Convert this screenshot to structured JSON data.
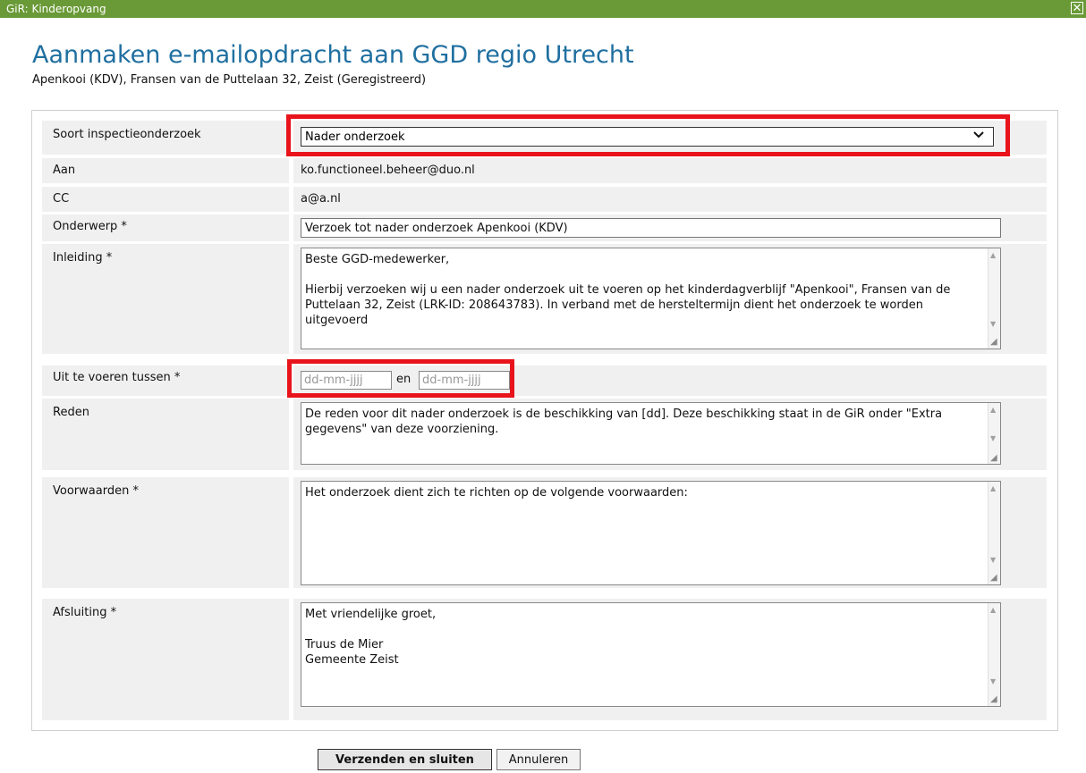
{
  "window": {
    "title": "GiR: Kinderopvang",
    "close_glyph": "✕"
  },
  "header": {
    "title": "Aanmaken e-mailopdracht aan GGD regio Utrecht",
    "subtitle": "Apenkooi (KDV), Fransen van de Puttelaan 32, Zeist (Geregistreerd)"
  },
  "form": {
    "soort": {
      "label": "Soort inspectieonderzoek",
      "value": "Nader onderzoek",
      "options": [
        "Nader onderzoek"
      ]
    },
    "aan": {
      "label": "Aan",
      "value": "ko.functioneel.beheer@duo.nl"
    },
    "cc": {
      "label": "CC",
      "value": "a@a.nl"
    },
    "onderwerp": {
      "label": "Onderwerp *",
      "value": "Verzoek tot nader onderzoek Apenkooi (KDV)"
    },
    "inleiding": {
      "label": "Inleiding *",
      "value": "Beste GGD-medewerker,\n\nHierbij verzoeken wij u een nader onderzoek uit te voeren op het kinderdagverblijf \"Apenkooi\", Fransen van de Puttelaan 32, Zeist (LRK-ID: 208643783). In verband met de hersteltermijn dient het onderzoek te worden uitgevoerd"
    },
    "uit_te_voeren": {
      "label": "Uit te voeren tussen *",
      "from_placeholder": "dd-mm-jjjj",
      "between": "en",
      "to_placeholder": "dd-mm-jjjj"
    },
    "reden": {
      "label": "Reden",
      "value": "De reden voor dit nader onderzoek is de beschikking van [dd]. Deze beschikking staat in de GiR onder \"Extra gegevens\" van deze voorziening."
    },
    "voorwaarden": {
      "label": "Voorwaarden *",
      "value": "Het onderzoek dient zich te richten op de volgende voorwaarden:"
    },
    "afsluiting": {
      "label": "Afsluiting *",
      "value": "Met vriendelijke groet,\n\nTruus de Mier\nGemeente Zeist"
    }
  },
  "buttons": {
    "submit": "Verzenden en sluiten",
    "cancel": "Annuleren"
  },
  "colors": {
    "titlebar": "#6a9a37",
    "title_text": "#1f6fa0",
    "highlight": "#e8131b",
    "row_bg": "#f0f0f0"
  },
  "icons": {
    "close": "close-icon",
    "dropdown": "chevron-down-icon",
    "resize": "resize-grip-icon"
  }
}
